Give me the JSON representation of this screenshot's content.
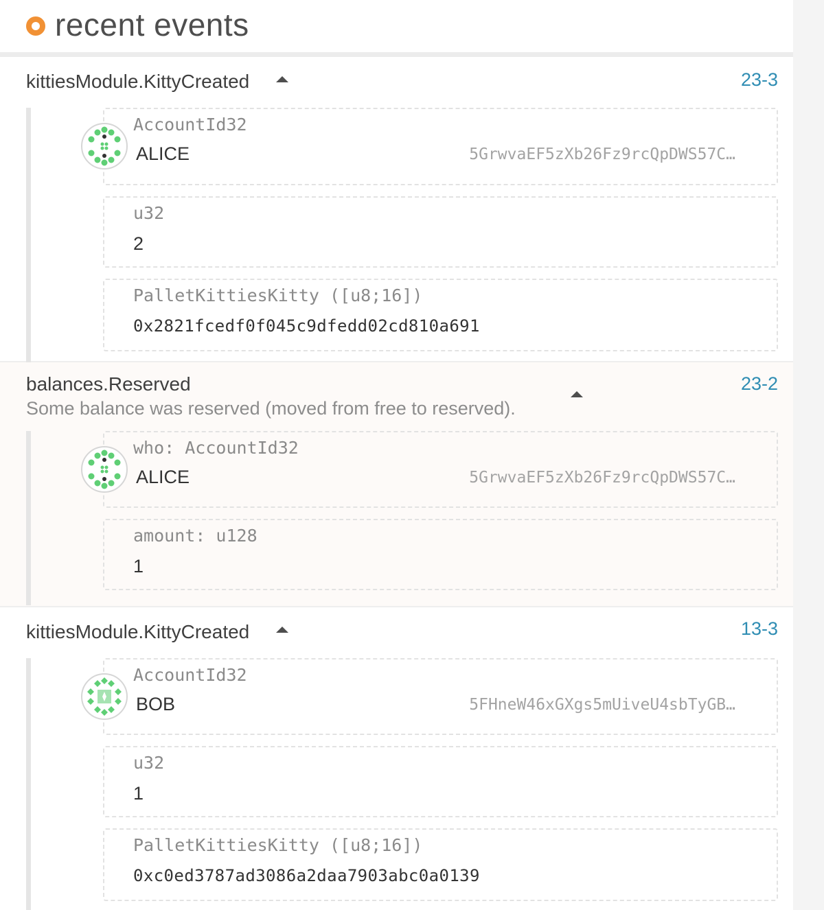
{
  "header": {
    "title": "recent events"
  },
  "events": [
    {
      "name": "kittiesModule.KittyCreated",
      "id": "23-3",
      "params": [
        {
          "type": "AccountId32",
          "account_name": "ALICE",
          "address": "5GrwvaEF5zXb26Fz9rcQpDWS57C…"
        },
        {
          "type": "u32",
          "value": "2"
        },
        {
          "type": "PalletKittiesKitty ([u8;16])",
          "value": "0x2821fcedf0f045c9dfedd02cd810a691"
        }
      ]
    },
    {
      "name": "balances.Reserved",
      "description": "Some balance was reserved (moved from free to reserved).",
      "id": "23-2",
      "params": [
        {
          "type": "who: AccountId32",
          "account_name": "ALICE",
          "address": "5GrwvaEF5zXb26Fz9rcQpDWS57C…"
        },
        {
          "type": "amount: u128",
          "value": "1"
        }
      ]
    },
    {
      "name": "kittiesModule.KittyCreated",
      "id": "13-3",
      "params": [
        {
          "type": "AccountId32",
          "account_name": "BOB",
          "address": "5FHneW46xGXgs5mUiveU4sbTyGB…"
        },
        {
          "type": "u32",
          "value": "1"
        },
        {
          "type": "PalletKittiesKitty ([u8;16])",
          "value": "0xc0ed3787ad3086a2daa7903abc0a0139"
        }
      ]
    }
  ],
  "colors": {
    "accent": "#f19135",
    "link": "#2f8db3",
    "identicon_green": "#5fcf75"
  },
  "icons": {
    "header": "orange-ring-icon",
    "caret": "caret-up-icon",
    "avatar": "polkadot-identicon-icon"
  }
}
